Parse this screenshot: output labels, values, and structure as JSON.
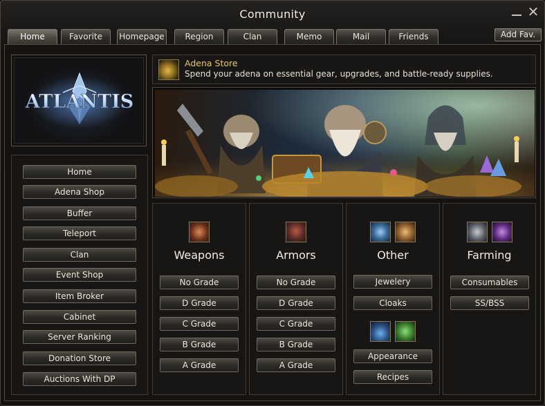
{
  "window": {
    "title": "Community"
  },
  "tabs": [
    "Home",
    "Favorite",
    "Homepage",
    "Region",
    "Clan",
    "Memo",
    "Mail",
    "Friends"
  ],
  "active_tab": "Home",
  "add_fav_label": "Add Fav.",
  "logo": {
    "text": "ATLANTIS"
  },
  "nav": [
    "Home",
    "Adena Shop",
    "Buffer",
    "Teleport",
    "Clan",
    "Event Shop",
    "Item Broker",
    "Cabinet",
    "Server Ranking",
    "Donation Store",
    "Auctions With DP"
  ],
  "store": {
    "title": "Adena Store",
    "description": "Spend your adena on essential gear, upgrades, and battle-ready supplies."
  },
  "categories": [
    {
      "title": "Weapons",
      "icons": [
        "weapon-icon"
      ],
      "buttons": [
        "No Grade",
        "D Grade",
        "C Grade",
        "B Grade",
        "A Grade"
      ]
    },
    {
      "title": "Armors",
      "icons": [
        "armor-icon"
      ],
      "buttons": [
        "No Grade",
        "D Grade",
        "C Grade",
        "B Grade",
        "A Grade"
      ]
    },
    {
      "title": "Other",
      "icons": [
        "jewelry-icon",
        "cloak-icon",
        "potion-icon",
        "appearance-icon"
      ],
      "buttons": [
        "Jewelery",
        "Cloaks",
        "Appearance",
        "Recipes"
      ]
    },
    {
      "title": "Farming",
      "icons": [
        "arrows-icon",
        "soulshot-icon"
      ],
      "buttons": [
        "Consumables",
        "SS/BSS"
      ]
    }
  ],
  "colors": {
    "accent_gold": "#e8c668",
    "frame": "#4f4b43"
  }
}
